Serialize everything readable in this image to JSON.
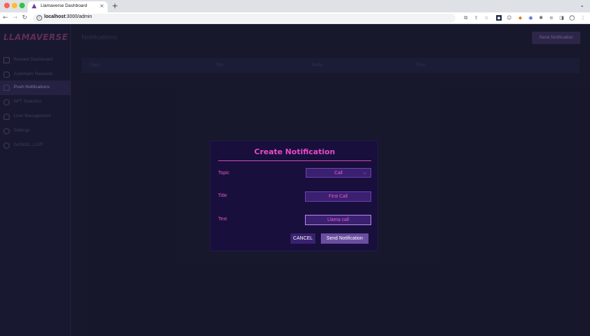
{
  "browser": {
    "tab_title": "Llamaverse Dashboard",
    "tab_close": "×",
    "new_tab": "+",
    "url_host": "localhost",
    "url_path": ":3000/admin"
  },
  "sidebar": {
    "logo": "LLAMAVERSE",
    "items": [
      {
        "label": "Reward Dashboard",
        "icon": "home-icon"
      },
      {
        "label": "Automatic Rewards",
        "icon": "calendar-icon"
      },
      {
        "label": "Push Notifications",
        "icon": "bell-icon",
        "active": true
      },
      {
        "label": "NFT Statistics",
        "icon": "clock-icon"
      },
      {
        "label": "User Management",
        "icon": "user-icon"
      },
      {
        "label": "Settings",
        "icon": "gear-icon"
      },
      {
        "label": "0x000G...L37F",
        "icon": "account-icon"
      }
    ]
  },
  "main": {
    "page_title": "Notifications",
    "send_button": "Send Notification",
    "table_headers": [
      "Topic",
      "Title",
      "Body",
      "Time"
    ]
  },
  "modal": {
    "title": "Create Notification",
    "topic_label": "Topic",
    "topic_value": "Call",
    "title_label": "Title",
    "title_value": "First Call",
    "text_label": "Text",
    "text_value": "Llama call",
    "cancel_label": "CANCEL",
    "send_label": "Send Notification"
  },
  "colors": {
    "accent": "#e64bc6",
    "modal_bg": "#180f3c",
    "field_bg": "#3b1f70"
  }
}
